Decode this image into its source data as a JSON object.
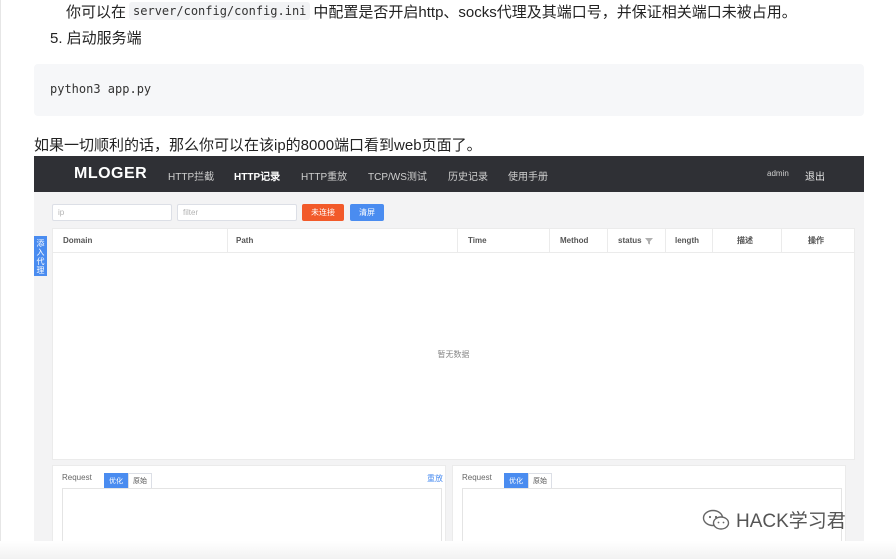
{
  "article": {
    "line1_before": "你可以在",
    "line1_code": "server/config/config.ini",
    "line1_after": "中配置是否开启http、socks代理及其端口号，并保证相关端口未被占用。",
    "step5": "5. 启动服务端",
    "code": "python3 app.py",
    "paragraph": "如果一切顺利的话，那么你可以在该ip的8000端口看到web页面了。"
  },
  "screenshot": {
    "logo": "MLOGER",
    "nav": [
      "HTTP拦截",
      "HTTP记录",
      "HTTP重放",
      "TCP/WS测试",
      "历史记录",
      "使用手册"
    ],
    "active_nav": "HTTP记录",
    "user": "admin",
    "logout": "退出",
    "side_tab": "添入代理",
    "ip_placeholder": "ip",
    "filter_placeholder": "filter",
    "btn_disconnected": "未连接",
    "btn_clear": "清屏",
    "columns": [
      "Domain",
      "Path",
      "Time",
      "Method",
      "status",
      "length",
      "描述",
      "操作"
    ],
    "empty_text": "暂无数据",
    "request_label": "Request",
    "tab_optimized": "优化",
    "tab_raw": "原始",
    "replay": "重放",
    "colors": {
      "navbar": "#2f3035",
      "primary": "#4a8cf0",
      "danger": "#f25a2a"
    }
  },
  "watermark": {
    "text": "HACK学习君",
    "icon": "wechat-icon"
  }
}
